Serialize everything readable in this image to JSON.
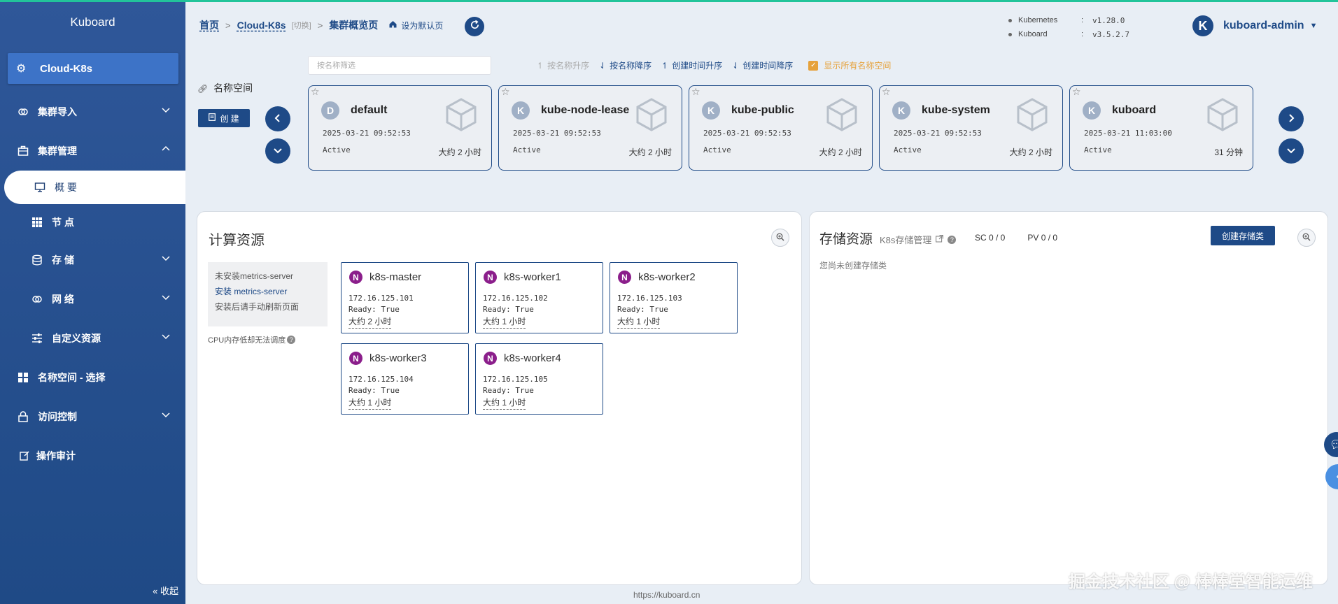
{
  "app": {
    "logo": "Kuboard"
  },
  "sidebar": {
    "cluster": "Cloud-K8s",
    "items": {
      "import": "集群导入",
      "manage": "集群管理",
      "overview": "概 要",
      "nodes": "节 点",
      "storage": "存 储",
      "network": "网 络",
      "custom": "自定义资源",
      "namespace": "名称空间 - 选择",
      "access": "访问控制",
      "audit": "操作审计"
    },
    "collapse": "收起"
  },
  "header": {
    "breadcrumb": {
      "home": "首页",
      "cluster": "Cloud-K8s",
      "switch": "[切换]",
      "current": "集群概览页",
      "set_default": "设为默认页"
    },
    "versions": [
      {
        "key": "Kubernetes",
        "value": "v1.28.0"
      },
      {
        "key": "Kuboard",
        "value": "v3.5.2.7"
      }
    ],
    "user": {
      "initial": "K",
      "name": "kuboard-admin"
    }
  },
  "namespaces": {
    "filter_placeholder": "按名称筛选",
    "sort": {
      "name_asc": "按名称升序",
      "name_desc": "按名称降序",
      "created_asc": "创建时间升序",
      "created_desc": "创建时间降序",
      "show_all": "显示所有名称空间"
    },
    "label": "名称空间",
    "create": "创 建",
    "cards": [
      {
        "letter": "D",
        "name": "default",
        "date": "2025-03-21 09:52:53",
        "status": "Active",
        "age": "大约 2 小时"
      },
      {
        "letter": "K",
        "name": "kube-node-lease",
        "date": "2025-03-21 09:52:53",
        "status": "Active",
        "age": "大约 2 小时"
      },
      {
        "letter": "K",
        "name": "kube-public",
        "date": "2025-03-21 09:52:53",
        "status": "Active",
        "age": "大约 2 小时"
      },
      {
        "letter": "K",
        "name": "kube-system",
        "date": "2025-03-21 09:52:53",
        "status": "Active",
        "age": "大约 2 小时"
      },
      {
        "letter": "K",
        "name": "kuboard",
        "date": "2025-03-21 11:03:00",
        "status": "Active",
        "age": "31 分钟"
      }
    ]
  },
  "compute": {
    "title": "计算资源",
    "metrics": {
      "not_installed": "未安装metrics-server",
      "install": "安装 metrics-server",
      "refresh_hint": "安装后请手动刷新页面"
    },
    "cpu_note": "CPU内存低却无法调度",
    "nodes": [
      {
        "badge": "N",
        "name": "k8s-master",
        "ip": "172.16.125.101",
        "ready": "Ready: True",
        "age": "大约 2 小时"
      },
      {
        "badge": "N",
        "name": "k8s-worker1",
        "ip": "172.16.125.102",
        "ready": "Ready: True",
        "age": "大约 1 小时"
      },
      {
        "badge": "N",
        "name": "k8s-worker2",
        "ip": "172.16.125.103",
        "ready": "Ready: True",
        "age": "大约 1 小时"
      },
      {
        "badge": "N",
        "name": "k8s-worker3",
        "ip": "172.16.125.104",
        "ready": "Ready: True",
        "age": "大约 1 小时"
      },
      {
        "badge": "N",
        "name": "k8s-worker4",
        "ip": "172.16.125.105",
        "ready": "Ready: True",
        "age": "大约 1 小时"
      }
    ]
  },
  "storage": {
    "title": "存储资源",
    "subtitle": "K8s存储管理",
    "sc": "SC 0 / 0",
    "pv": "PV 0 / 0",
    "create_sc": "创建存储类",
    "empty": "您尚未创建存储类"
  },
  "footer": {
    "url": "https://kuboard.cn",
    "watermark": "掘金技术社区 @ 棒棒堂智能运维"
  },
  "colors": {
    "primary": "#1e4a87",
    "sidebar": "#2f5799",
    "accent": "#22c49a",
    "warning": "#e6a23c",
    "node_badge": "#8b1e8b"
  }
}
